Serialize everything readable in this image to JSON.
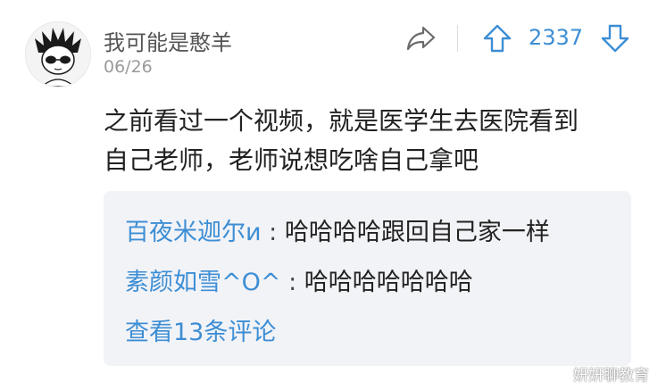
{
  "comment": {
    "username": "我可能是憨羊",
    "date": "06/26",
    "vote_count": "2337",
    "text_line1": "之前看过一个视频，就是医学生去医院看到",
    "text_line2": "自己老师，老师说想吃啥自己拿吧"
  },
  "replies": [
    {
      "user": "百夜米迦尔и",
      "separator": " : ",
      "text": "哈哈哈哈跟回自己家一样"
    },
    {
      "user": "素颜如雪^O^",
      "separator": " : ",
      "text": "哈哈哈哈哈哈哈"
    }
  ],
  "view_more_label": "查看13条评论",
  "watermark": "妍妍聊教育",
  "icons": {
    "share": "share-arrow-icon",
    "upvote": "upvote-arrow-icon",
    "downvote": "downvote-arrow-icon"
  },
  "colors": {
    "accent": "#3d8ed4",
    "reply_bg": "#f2f3f7",
    "text": "#222222",
    "muted": "#9a9a9a"
  }
}
